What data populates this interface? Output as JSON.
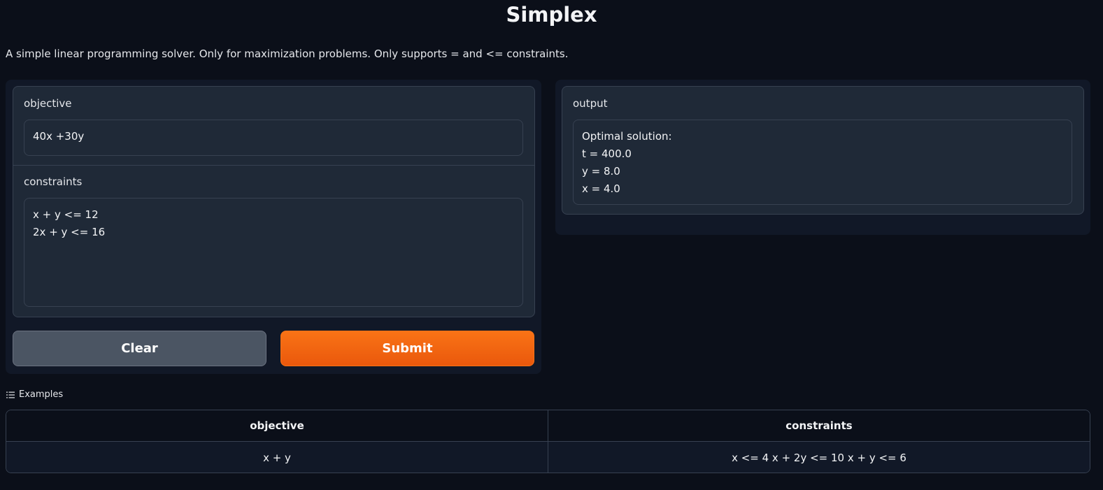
{
  "header": {
    "title": "Simplex",
    "description": "A simple linear programming solver. Only for maximization problems. Only supports = and <= constraints."
  },
  "inputs": {
    "objective": {
      "label": "objective",
      "value": "40x +30y"
    },
    "constraints": {
      "label": "constraints",
      "value": "x + y <= 12\n2x + y <= 16"
    }
  },
  "buttons": {
    "clear": "Clear",
    "submit": "Submit"
  },
  "output": {
    "label": "output",
    "value": "Optimal solution:\nt = 400.0\ny = 8.0\nx = 4.0"
  },
  "examples": {
    "label": "Examples",
    "icon": "list-icon",
    "headers": [
      "objective",
      "constraints"
    ],
    "rows": [
      [
        "x + y",
        "x <= 4 x + 2y <= 10 x + y <= 6"
      ]
    ]
  },
  "colors": {
    "accent": "#f97316",
    "background": "#0b0f19",
    "panel": "#1f2937"
  }
}
